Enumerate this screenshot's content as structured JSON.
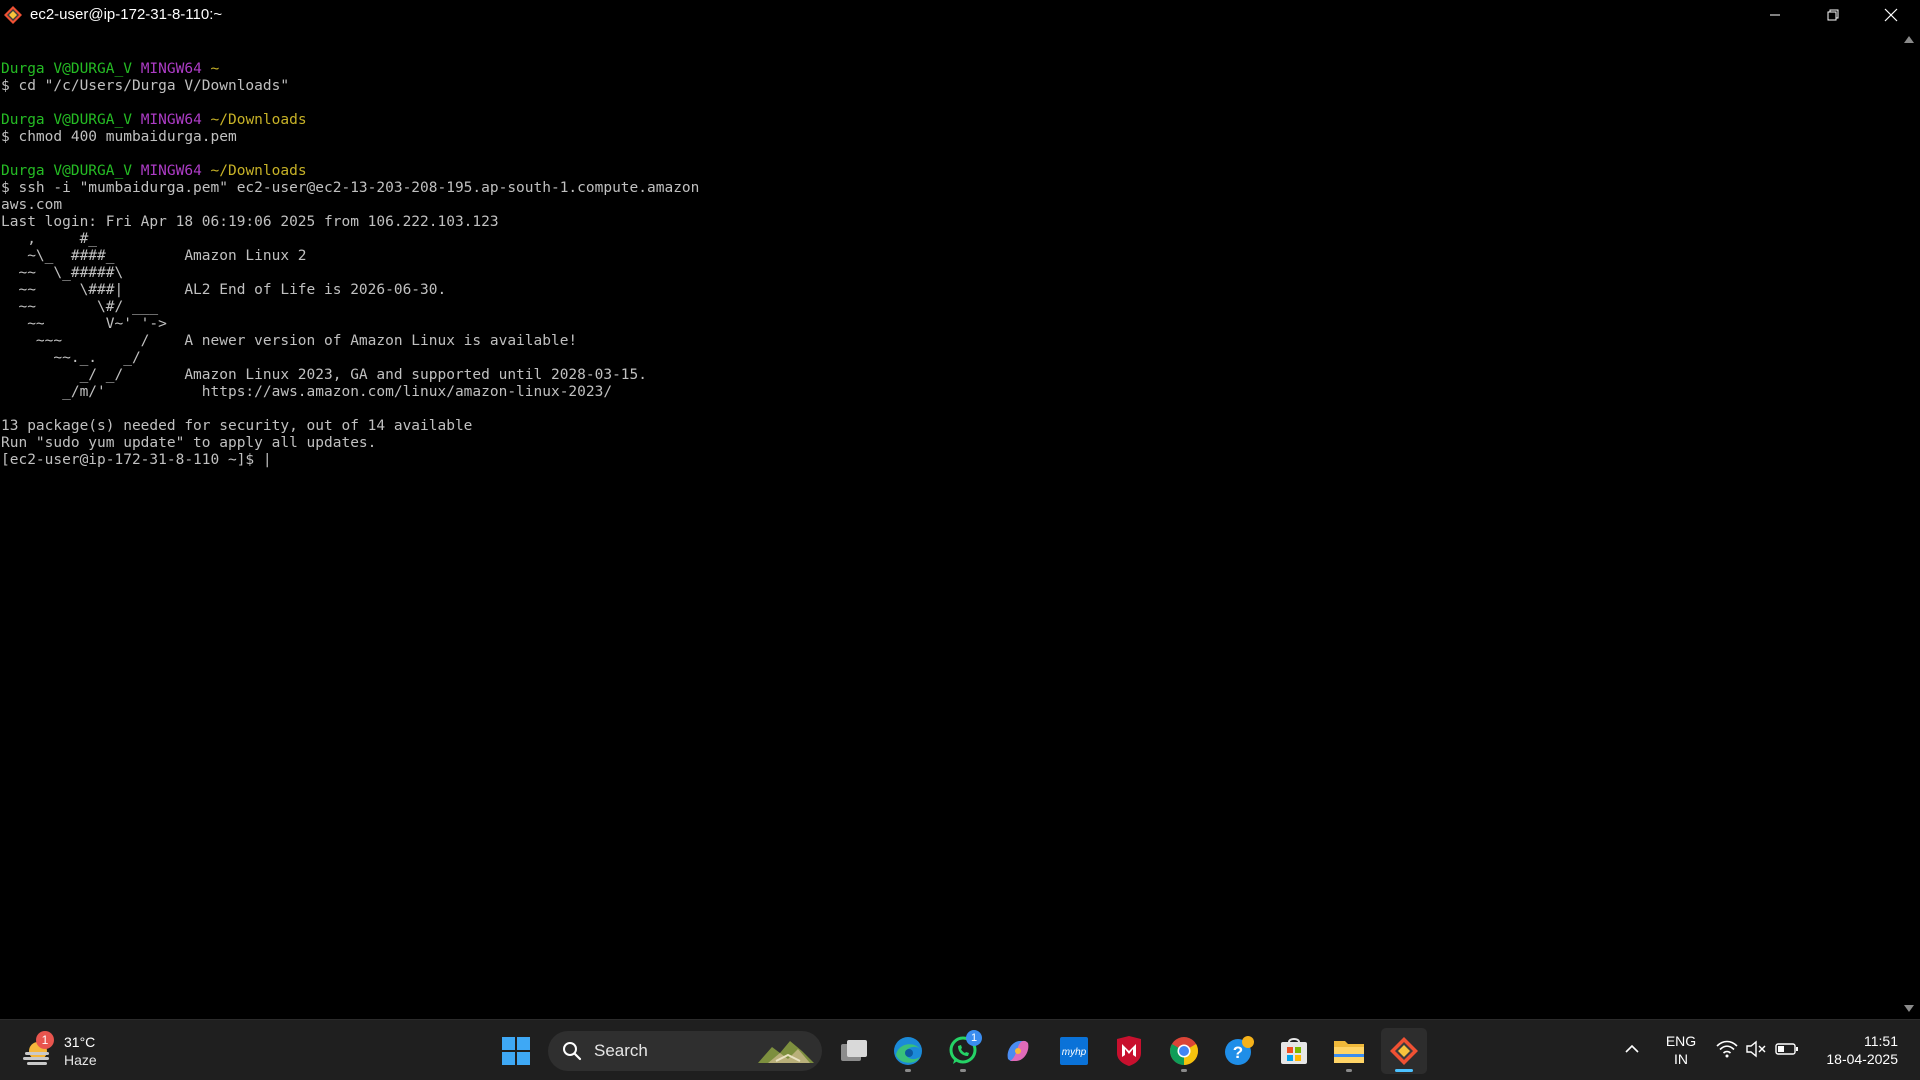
{
  "window": {
    "title": "ec2-user@ip-172-31-8-110:~"
  },
  "terminal": {
    "lines": [
      {
        "segments": [
          {
            "t": "",
            "c": "white"
          }
        ]
      },
      {
        "segments": [
          {
            "t": "Durga V@DURGA_V ",
            "c": "green"
          },
          {
            "t": "MINGW64 ",
            "c": "purple"
          },
          {
            "t": "~",
            "c": "yellow"
          }
        ]
      },
      {
        "segments": [
          {
            "t": "$ cd \"/c/Users/Durga V/Downloads\"",
            "c": "white"
          }
        ]
      },
      {
        "segments": [
          {
            "t": "",
            "c": "white"
          }
        ]
      },
      {
        "segments": [
          {
            "t": "Durga V@DURGA_V ",
            "c": "green"
          },
          {
            "t": "MINGW64 ",
            "c": "purple"
          },
          {
            "t": "~/Downloads",
            "c": "yellow"
          }
        ]
      },
      {
        "segments": [
          {
            "t": "$ chmod 400 mumbaidurga.pem",
            "c": "white"
          }
        ]
      },
      {
        "segments": [
          {
            "t": "",
            "c": "white"
          }
        ]
      },
      {
        "segments": [
          {
            "t": "Durga V@DURGA_V ",
            "c": "green"
          },
          {
            "t": "MINGW64 ",
            "c": "purple"
          },
          {
            "t": "~/Downloads",
            "c": "yellow"
          }
        ]
      },
      {
        "segments": [
          {
            "t": "$ ssh -i \"mumbaidurga.pem\" ec2-user@ec2-13-203-208-195.ap-south-1.compute.amazon",
            "c": "white"
          }
        ]
      },
      {
        "segments": [
          {
            "t": "aws.com",
            "c": "white"
          }
        ]
      },
      {
        "segments": [
          {
            "t": "Last login: Fri Apr 18 06:19:06 2025 from 106.222.103.123",
            "c": "white"
          }
        ]
      },
      {
        "segments": [
          {
            "t": "   ,     #_",
            "c": "white"
          }
        ]
      },
      {
        "segments": [
          {
            "t": "   ~\\_  ####_        Amazon Linux 2",
            "c": "white"
          }
        ]
      },
      {
        "segments": [
          {
            "t": "  ~~  \\_#####\\",
            "c": "white"
          }
        ]
      },
      {
        "segments": [
          {
            "t": "  ~~     \\###|       AL2 End of Life is 2026-06-30.",
            "c": "white"
          }
        ]
      },
      {
        "segments": [
          {
            "t": "  ~~       \\#/ ___",
            "c": "white"
          }
        ]
      },
      {
        "segments": [
          {
            "t": "   ~~       V~' '->",
            "c": "white"
          }
        ]
      },
      {
        "segments": [
          {
            "t": "    ~~~         /    A newer version of Amazon Linux is available!",
            "c": "white"
          }
        ]
      },
      {
        "segments": [
          {
            "t": "      ~~._.   _/",
            "c": "white"
          }
        ]
      },
      {
        "segments": [
          {
            "t": "         _/ _/       Amazon Linux 2023, GA and supported until 2028-03-15.",
            "c": "white"
          }
        ]
      },
      {
        "segments": [
          {
            "t": "       _/m/'           https://aws.amazon.com/linux/amazon-linux-2023/",
            "c": "white"
          }
        ]
      },
      {
        "segments": [
          {
            "t": "",
            "c": "white"
          }
        ]
      },
      {
        "segments": [
          {
            "t": "13 package(s) needed for security, out of 14 available",
            "c": "white"
          }
        ]
      },
      {
        "segments": [
          {
            "t": "Run \"sudo yum update\" to apply all updates.",
            "c": "white"
          }
        ]
      },
      {
        "segments": [
          {
            "t": "[ec2-user@ip-172-31-8-110 ~]$ ",
            "c": "white"
          },
          {
            "t": "|",
            "c": "white"
          }
        ]
      }
    ]
  },
  "taskbar": {
    "weather": {
      "temp": "31°C",
      "condition": "Haze",
      "badge": "1"
    },
    "search": {
      "placeholder": "Search"
    },
    "whatsapp_badge": "1",
    "tray": {
      "lang_top": "ENG",
      "lang_bottom": "IN"
    },
    "clock": {
      "time": "11:51",
      "date": "18-04-2025"
    }
  }
}
